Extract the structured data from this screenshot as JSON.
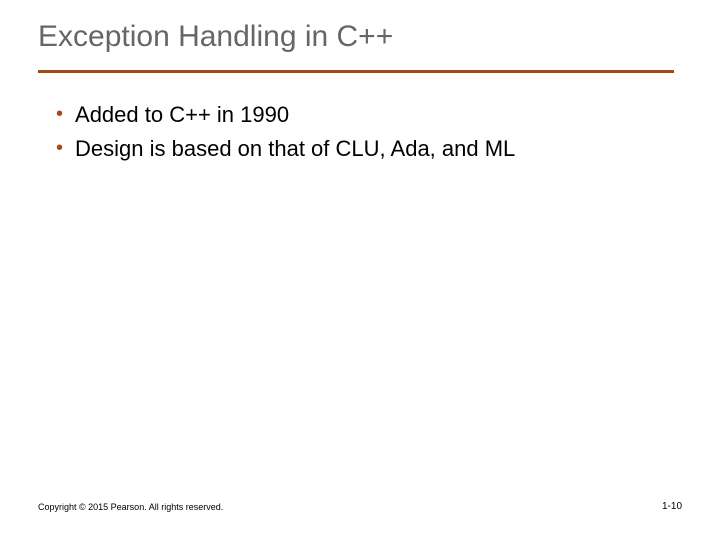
{
  "title": "Exception Handling in C++",
  "bullets": [
    "Added to C++ in 1990",
    "Design is based on that of CLU, Ada, and ML"
  ],
  "footer": {
    "copyright": "Copyright © 2015 Pearson. All rights reserved.",
    "page": "1-10"
  },
  "colors": {
    "title": "#666666",
    "rule": "#a24b18",
    "bullet": "#a24b18"
  }
}
